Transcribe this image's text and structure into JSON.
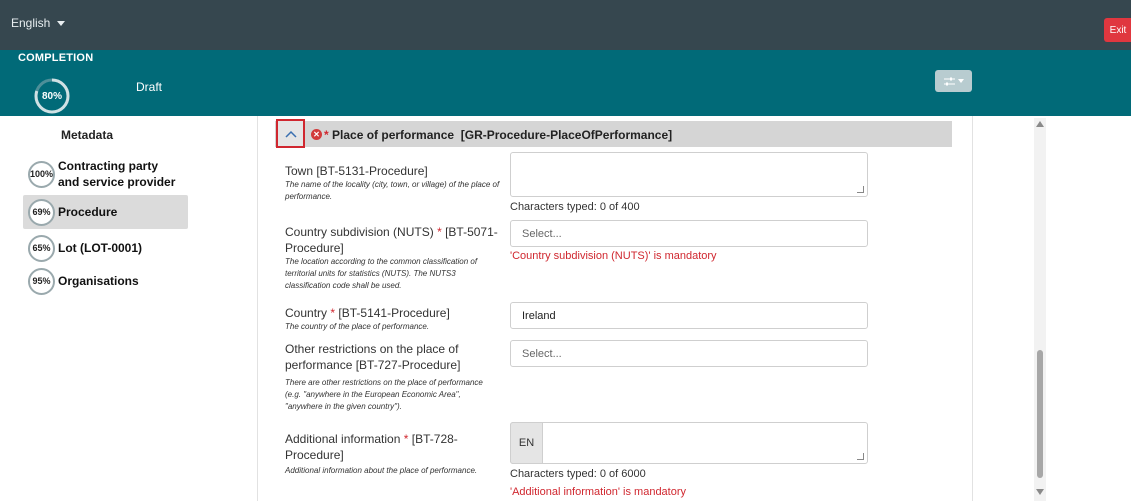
{
  "topbar": {
    "language": "English",
    "exit_label": "Exit"
  },
  "header": {
    "completion_label": "COMPLETION",
    "progress": "80%",
    "progress_value": 0.8,
    "status": "Draft",
    "settings_icon": "sliders-icon"
  },
  "sidebar": {
    "title": "Metadata",
    "items": [
      {
        "percent": "100%",
        "label": "Contracting party and service provider"
      },
      {
        "percent": "69%",
        "label": "Procedure"
      },
      {
        "percent": "65%",
        "label": "Lot (LOT-0001)"
      },
      {
        "percent": "95%",
        "label": "Organisations"
      }
    ]
  },
  "section": {
    "title": "Place of performance",
    "id": "[GR-Procedure-PlaceOfPerformance]",
    "required_mark": "*"
  },
  "fields": {
    "town": {
      "label": "Town [BT-5131-Procedure]",
      "desc": "The name of the locality (city, town, or village) of the place of performance.",
      "counter": "Characters typed: 0 of 400"
    },
    "nuts": {
      "label": "Country subdivision (NUTS)",
      "code": "[BT-5071-Procedure]",
      "desc": "The location according to the common classification of territorial units for statistics (NUTS). The NUTS3 classification code shall be used.",
      "placeholder": "Select...",
      "error": "'Country subdivision (NUTS)' is mandatory"
    },
    "country": {
      "label": "Country",
      "code": "[BT-5141-Procedure]",
      "desc": "The country of the place of performance.",
      "value": "Ireland"
    },
    "other": {
      "label": "Other restrictions on the place of performance [BT-727-Procedure]",
      "desc": "There are other restrictions on the place of performance (e.g. \"anywhere in the European Economic Area\", \"anywhere in the given country\").",
      "placeholder": "Select..."
    },
    "additional": {
      "label": "Additional information",
      "code": "[BT-728-Procedure]",
      "desc": "Additional information about the place of performance.",
      "lang": "EN",
      "counter": "Characters typed: 0 of 6000",
      "error": "'Additional information' is mandatory"
    }
  }
}
